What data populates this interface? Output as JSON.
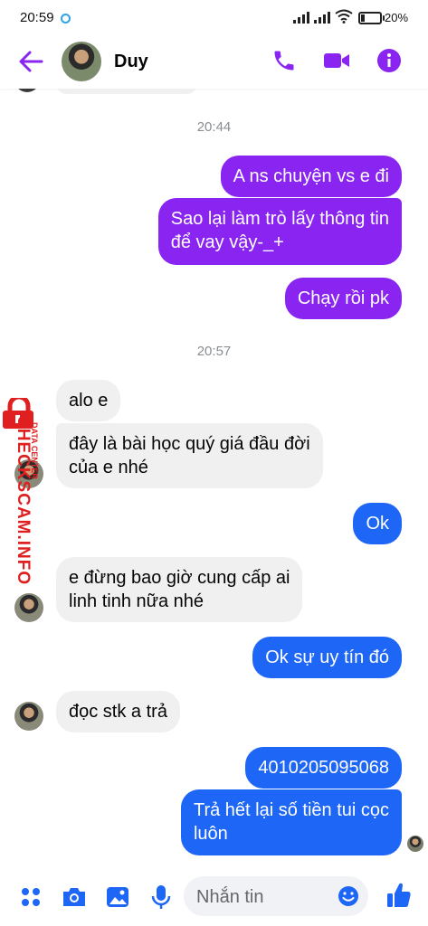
{
  "status_bar": {
    "time": "20:59",
    "battery": "20%"
  },
  "header": {
    "contact_name": "Duy"
  },
  "colors": {
    "accent": "#8a24f0",
    "out_blue": "#1e66f5",
    "incoming": "#f0f0f0"
  },
  "icons": [
    "back-arrow-icon",
    "phone-icon",
    "video-camera-icon",
    "info-icon",
    "apps-grid-icon",
    "camera-icon",
    "image-icon",
    "microphone-icon",
    "emoji-icon",
    "thumbs-up-icon",
    "lock-icon"
  ],
  "messages": {
    "ts1": "20:44",
    "m1": "A ns chuyện vs e đi",
    "m2a": "Sao lại làm trò lấy thông tin",
    "m2b": "để vay vậy-_+",
    "m3": "Chạy rồi pk",
    "ts2": "20:57",
    "m4": "alo e",
    "m5a": "đây là bài học quý giá đầu đời",
    "m5b": "của e nhé",
    "m6": "Ok",
    "m7a": "e đừng bao giờ cung cấp ai",
    "m7b": "linh tinh nữa nhé",
    "m8": "Ok sự uy tín đó",
    "m9": "đọc stk a trả",
    "m10": "4010205095068",
    "m11a": "Trả hết lại số tiền tui cọc",
    "m11b": "luôn"
  },
  "watermark": {
    "main": "CHECKSCAM.INFO",
    "sub": "DATA CENTER"
  },
  "composer": {
    "placeholder": "Nhắn tin"
  }
}
